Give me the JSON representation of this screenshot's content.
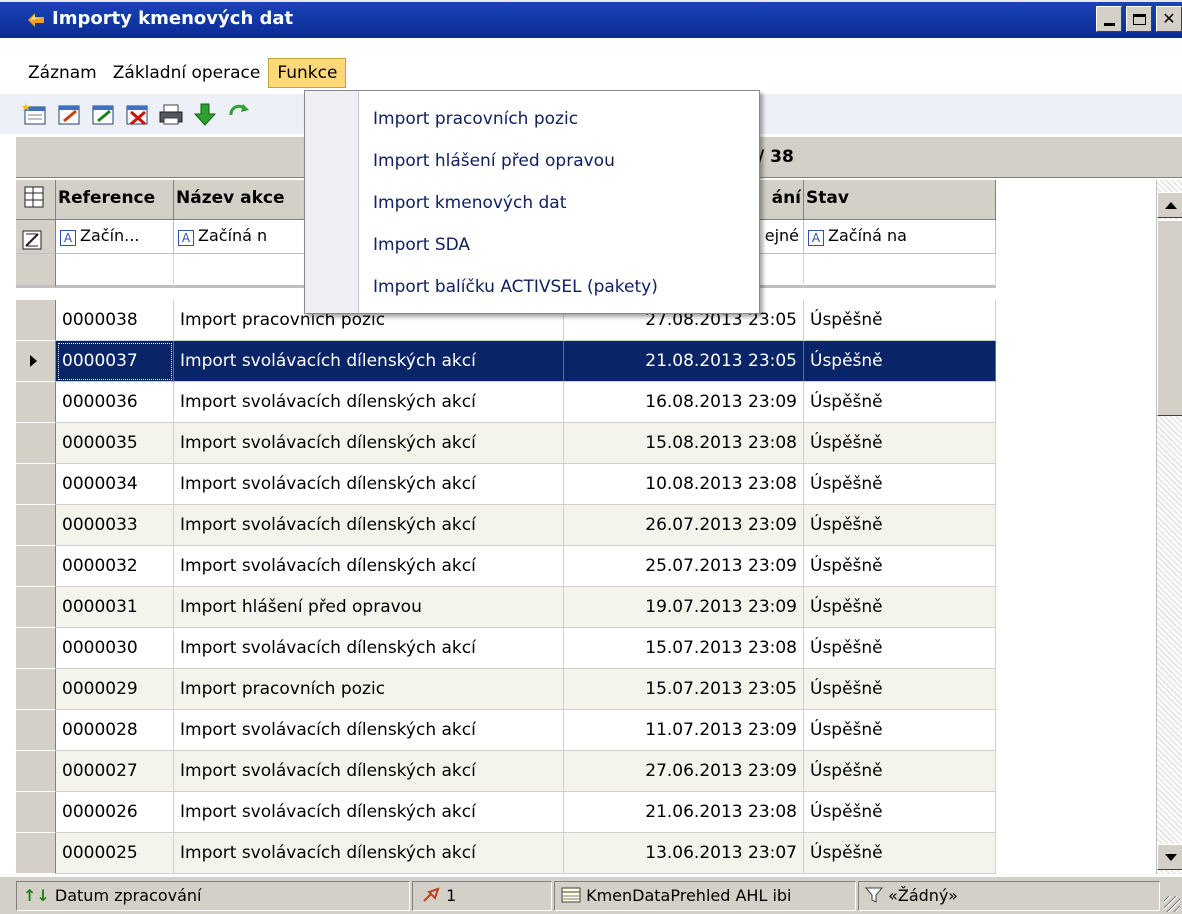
{
  "window": {
    "title": "Importy kmenových dat",
    "controls": [
      "_",
      "□",
      "X"
    ]
  },
  "menubar": {
    "items": [
      "Záznam",
      "Základní operace",
      "Funkce"
    ],
    "active": "Funkce"
  },
  "toolbar": {
    "icons": [
      "new-record-icon",
      "edit-icon",
      "edit-copy-icon",
      "delete-icon",
      "print-icon",
      "move-down-icon",
      "refresh-icon"
    ]
  },
  "recordbar": {
    "count": "/ 38"
  },
  "dropdown": {
    "items": [
      "Import pracovních pozic",
      "Import hlášení před opravou",
      "Import kmenových dat",
      "Import SDA",
      "Import balíčku ACTIVSEL (pakety)"
    ]
  },
  "grid": {
    "columns": [
      "Reference",
      "Název akce",
      "ání",
      "Stav"
    ],
    "filters": [
      "Začín...",
      "Začíná n",
      "ejné",
      "Začíná na"
    ],
    "rows": [
      {
        "ref": "0000038",
        "name": "Import pracovních pozic",
        "date": "27.08.2013 23:05",
        "state": "Úspěšně"
      },
      {
        "ref": "0000037",
        "name": "Import svolávacích dílenských akcí",
        "date": "21.08.2013 23:05",
        "state": "Úspěšně"
      },
      {
        "ref": "0000036",
        "name": "Import svolávacích dílenských akcí",
        "date": "16.08.2013 23:09",
        "state": "Úspěšně"
      },
      {
        "ref": "0000035",
        "name": "Import svolávacích dílenských akcí",
        "date": "15.08.2013 23:08",
        "state": "Úspěšně"
      },
      {
        "ref": "0000034",
        "name": "Import svolávacích dílenských akcí",
        "date": "10.08.2013 23:08",
        "state": "Úspěšně"
      },
      {
        "ref": "0000033",
        "name": "Import svolávacích dílenských akcí",
        "date": "26.07.2013 23:09",
        "state": "Úspěšně"
      },
      {
        "ref": "0000032",
        "name": "Import svolávacích dílenských akcí",
        "date": "25.07.2013 23:09",
        "state": "Úspěšně"
      },
      {
        "ref": "0000031",
        "name": "Import hlášení před opravou",
        "date": "19.07.2013 23:09",
        "state": "Úspěšně"
      },
      {
        "ref": "0000030",
        "name": "Import svolávacích dílenských akcí",
        "date": "15.07.2013 23:08",
        "state": "Úspěšně"
      },
      {
        "ref": "0000029",
        "name": "Import pracovních pozic",
        "date": "15.07.2013 23:05",
        "state": "Úspěšně"
      },
      {
        "ref": "0000028",
        "name": "Import svolávacích dílenských akcí",
        "date": "11.07.2013 23:09",
        "state": "Úspěšně"
      },
      {
        "ref": "0000027",
        "name": "Import svolávacích dílenských akcí",
        "date": "27.06.2013 23:09",
        "state": "Úspěšně"
      },
      {
        "ref": "0000026",
        "name": "Import svolávacích dílenských akcí",
        "date": "21.06.2013 23:08",
        "state": "Úspěšně"
      },
      {
        "ref": "0000025",
        "name": "Import svolávacích dílenských akcí",
        "date": "13.06.2013 23:07",
        "state": "Úspěšně"
      }
    ],
    "selected_ref": "0000037"
  },
  "statusbar": {
    "sort": "Datum zpracování",
    "count": "1",
    "view": "KmenDataPrehled AHL ibi",
    "filter": "«Žádný»"
  },
  "colors": {
    "titlebar": "#0a2a94",
    "selection": "#0a2468",
    "menu_highlight": "#ffd87a"
  }
}
